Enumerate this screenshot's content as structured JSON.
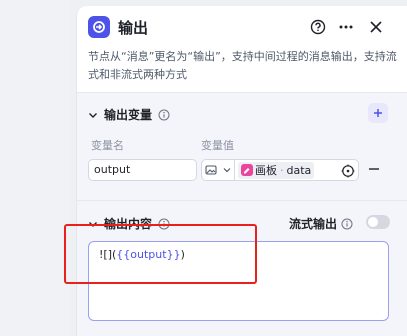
{
  "node": {
    "title": "输出",
    "description": "节点从“消息”更名为“输出”，支持中间过程的消息输出，支持流式和非流式两种方式"
  },
  "output_variables": {
    "title": "输出变量",
    "col_name": "变量名",
    "col_value": "变量值",
    "rows": [
      {
        "name": "output",
        "ref_node": "画板",
        "ref_field": "data"
      }
    ]
  },
  "output_content": {
    "title": "输出内容",
    "stream_label": "流式输出",
    "stream_enabled": false,
    "text_prefix": "![](",
    "text_var": "{{output}}",
    "text_suffix": ")"
  },
  "colors": {
    "accent": "#4d53e8",
    "annotation": "#e8211d",
    "tag": "#e9459e"
  }
}
